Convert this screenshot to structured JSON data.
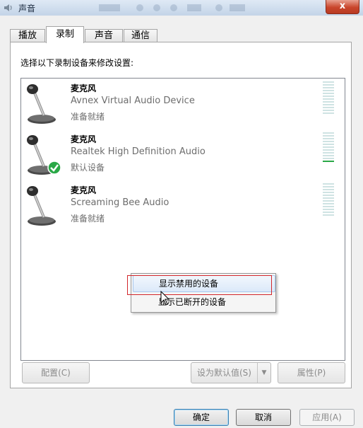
{
  "window": {
    "title": "声音",
    "close_label": "x"
  },
  "tabs": [
    {
      "label": "播放"
    },
    {
      "label": "录制"
    },
    {
      "label": "声音"
    },
    {
      "label": "通信"
    }
  ],
  "active_tab": "录制",
  "instruction": "选择以下录制设备来修改设置:",
  "devices": [
    {
      "name": "麦克风",
      "description": "Avnex Virtual Audio Device",
      "status": "准备就绪",
      "is_default": false
    },
    {
      "name": "麦克风",
      "description": "Realtek High Definition Audio",
      "status": "默认设备",
      "is_default": true
    },
    {
      "name": "麦克风",
      "description": "Screaming Bee Audio",
      "status": "准备就绪",
      "is_default": false
    }
  ],
  "context_menu": {
    "items": [
      {
        "label": "显示禁用的设备",
        "highlighted": true
      },
      {
        "label": "显示已断开的设备",
        "highlighted": false
      }
    ]
  },
  "panel_buttons": {
    "configure": "配置(C)",
    "set_default": "设为默认值(S)",
    "properties": "属性(P)"
  },
  "dialog_buttons": {
    "ok": "确定",
    "cancel": "取消",
    "apply": "应用(A)"
  },
  "colors": {
    "default_check": "#2aa847",
    "highlight_border": "#d2262b"
  }
}
